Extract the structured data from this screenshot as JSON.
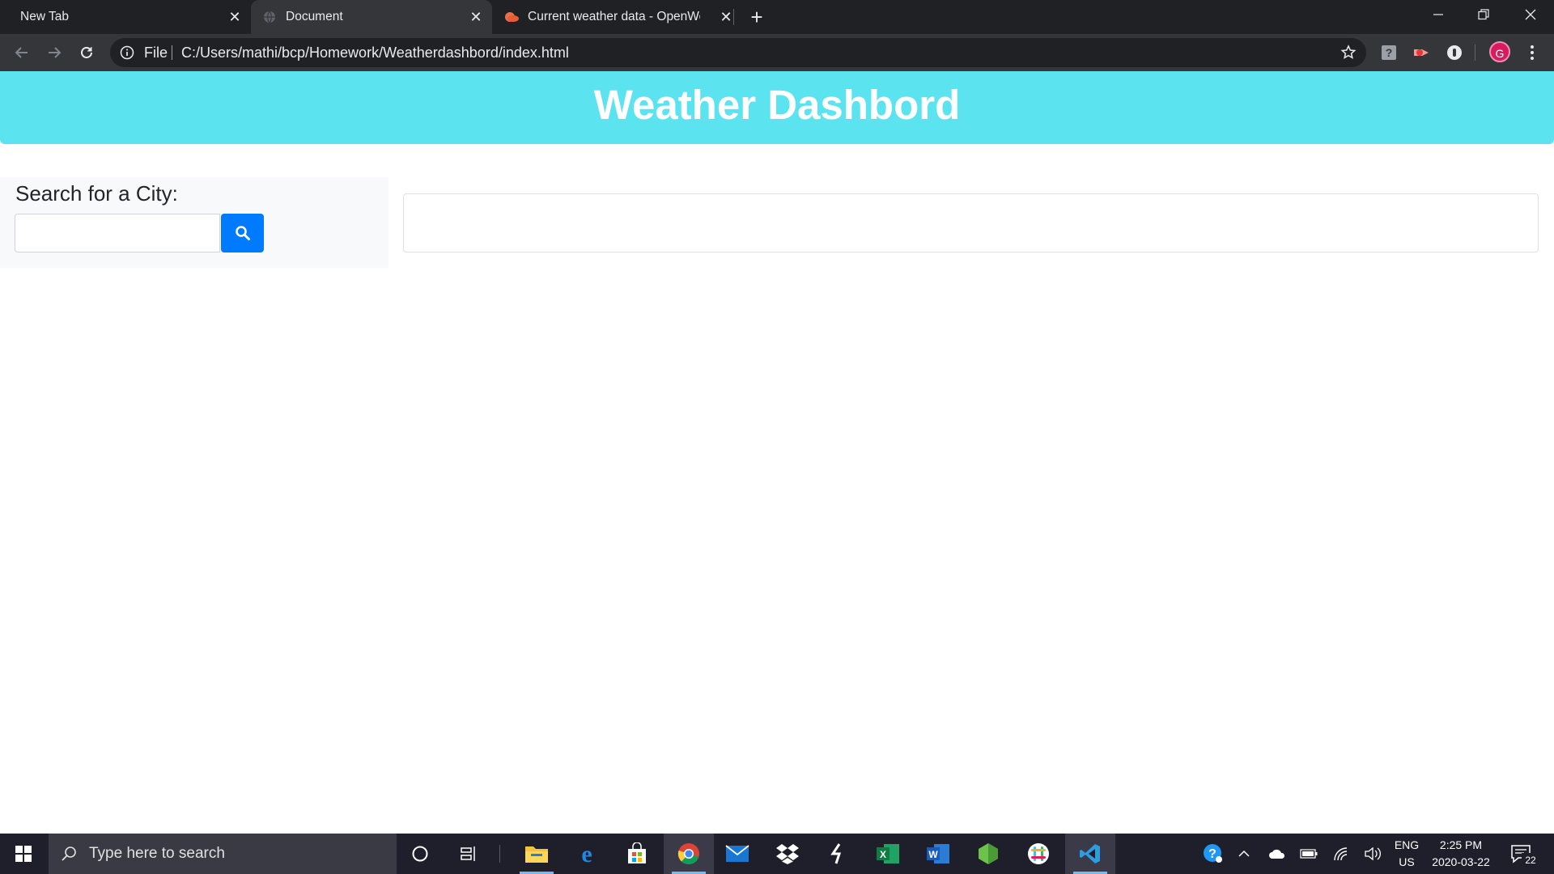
{
  "browser": {
    "tabs": [
      {
        "label": "New Tab",
        "active": false
      },
      {
        "label": "Document",
        "active": true
      },
      {
        "label": "Current weather data - OpenWea",
        "active": false
      }
    ],
    "address": {
      "scheme_label": "File",
      "url": "C:/Users/mathi/bcp/Homework/Weatherdashbord/index.html"
    },
    "profile_initial": "G"
  },
  "page": {
    "header_title": "Weather Dashbord",
    "search": {
      "title": "Search for a City:",
      "input_value": "",
      "input_placeholder": "",
      "button_icon": "search-icon"
    }
  },
  "taskbar": {
    "search_placeholder": "Type here to search",
    "language_line1": "ENG",
    "language_line2": "US",
    "time": "2:25 PM",
    "date": "2020-03-22",
    "notification_count": "22",
    "apps": [
      "file-explorer",
      "edge",
      "store",
      "chrome",
      "mail",
      "dropbox",
      "git-kraken",
      "excel",
      "word",
      "node",
      "slack",
      "vscode"
    ]
  },
  "colors": {
    "header_bg": "#5ce3f0",
    "search_button": "#007bff",
    "chrome_dark": "#202124",
    "taskbar_bg": "#1f1f2b"
  }
}
